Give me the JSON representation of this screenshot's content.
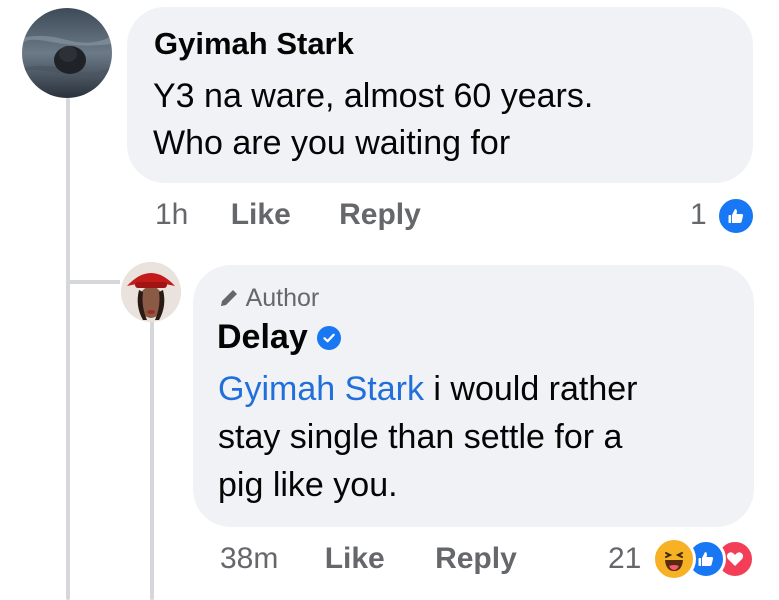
{
  "comment1": {
    "author": "Gyimah Stark",
    "lines": [
      "Y3 na ware, almost 60 years.",
      "Who are you waiting for"
    ],
    "time": "1h",
    "like_label": "Like",
    "reply_label": "Reply",
    "reaction_count": "1",
    "reactions": [
      "like-icon"
    ]
  },
  "reply1": {
    "badge": "Author",
    "author": "Delay",
    "verified": true,
    "mention": "Gyimah Stark",
    "line1_rest": " i would rather",
    "line2": "stay single than settle for a",
    "line3": "pig like you.",
    "time": "38m",
    "like_label": "Like",
    "reply_label": "Reply",
    "reaction_count": "21",
    "reactions": [
      "haha-icon",
      "like-icon",
      "love-icon"
    ]
  },
  "colors": {
    "bubble": "#f0f2f5",
    "meta_text": "#65676b",
    "mention": "#216fdb",
    "like_blue": "#1877f2",
    "love_red": "#f33e58",
    "haha_yellow": "#f7b125"
  }
}
